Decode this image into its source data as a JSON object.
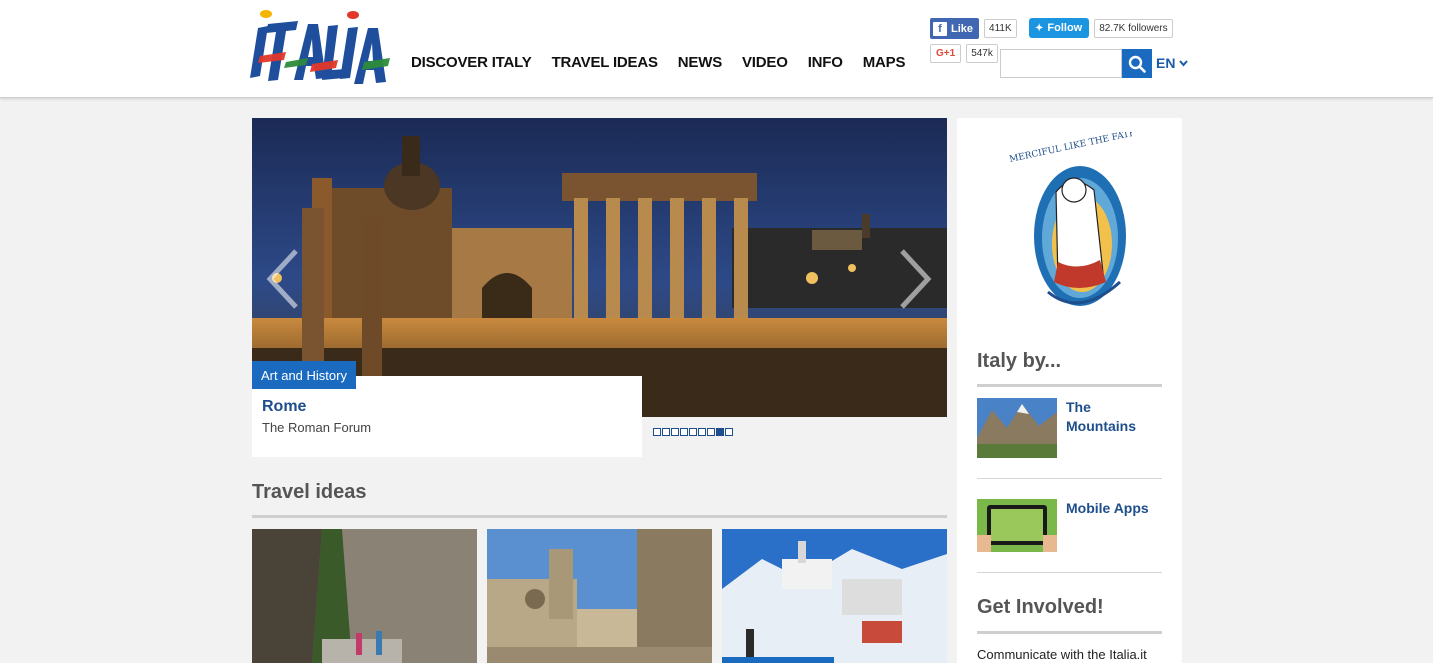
{
  "brand": {
    "logo_text": "ITALIA"
  },
  "nav": {
    "items": [
      {
        "label": "DISCOVER ITALY"
      },
      {
        "label": "TRAVEL IDEAS"
      },
      {
        "label": "NEWS"
      },
      {
        "label": "VIDEO"
      },
      {
        "label": "INFO"
      },
      {
        "label": "MAPS"
      }
    ]
  },
  "social": {
    "facebook": {
      "label": "Like",
      "count": "411K"
    },
    "twitter": {
      "label": "Follow",
      "count": "82.7K followers"
    },
    "gplus": {
      "label": "G+1",
      "count": "547k"
    }
  },
  "search": {
    "placeholder": "",
    "value": ""
  },
  "language": {
    "current": "EN"
  },
  "slider": {
    "category": "Art and History",
    "title": "Rome",
    "subtitle": "The Roman Forum",
    "slide_count": 9,
    "active_index": 8
  },
  "travel_ideas": {
    "heading": "Travel ideas",
    "cards": [
      {
        "icon": "gorge-photo"
      },
      {
        "icon": "cathedral-square-photo"
      },
      {
        "icon": "snowy-village-photo"
      }
    ]
  },
  "sidebar": {
    "jubilee_text": "MERCIFUL LIKE THE FATHER",
    "italy_by": {
      "heading": "Italy by...",
      "items": [
        {
          "label": "The Mountains"
        },
        {
          "label": "Mobile Apps"
        }
      ]
    },
    "get_involved": {
      "heading": "Get Involved!",
      "text": "Communicate with the Italia.it"
    }
  },
  "colors": {
    "accent": "#1a6bc0",
    "link": "#1f4e8c",
    "facebook": "#4267b2",
    "twitter": "#1b95e0"
  }
}
